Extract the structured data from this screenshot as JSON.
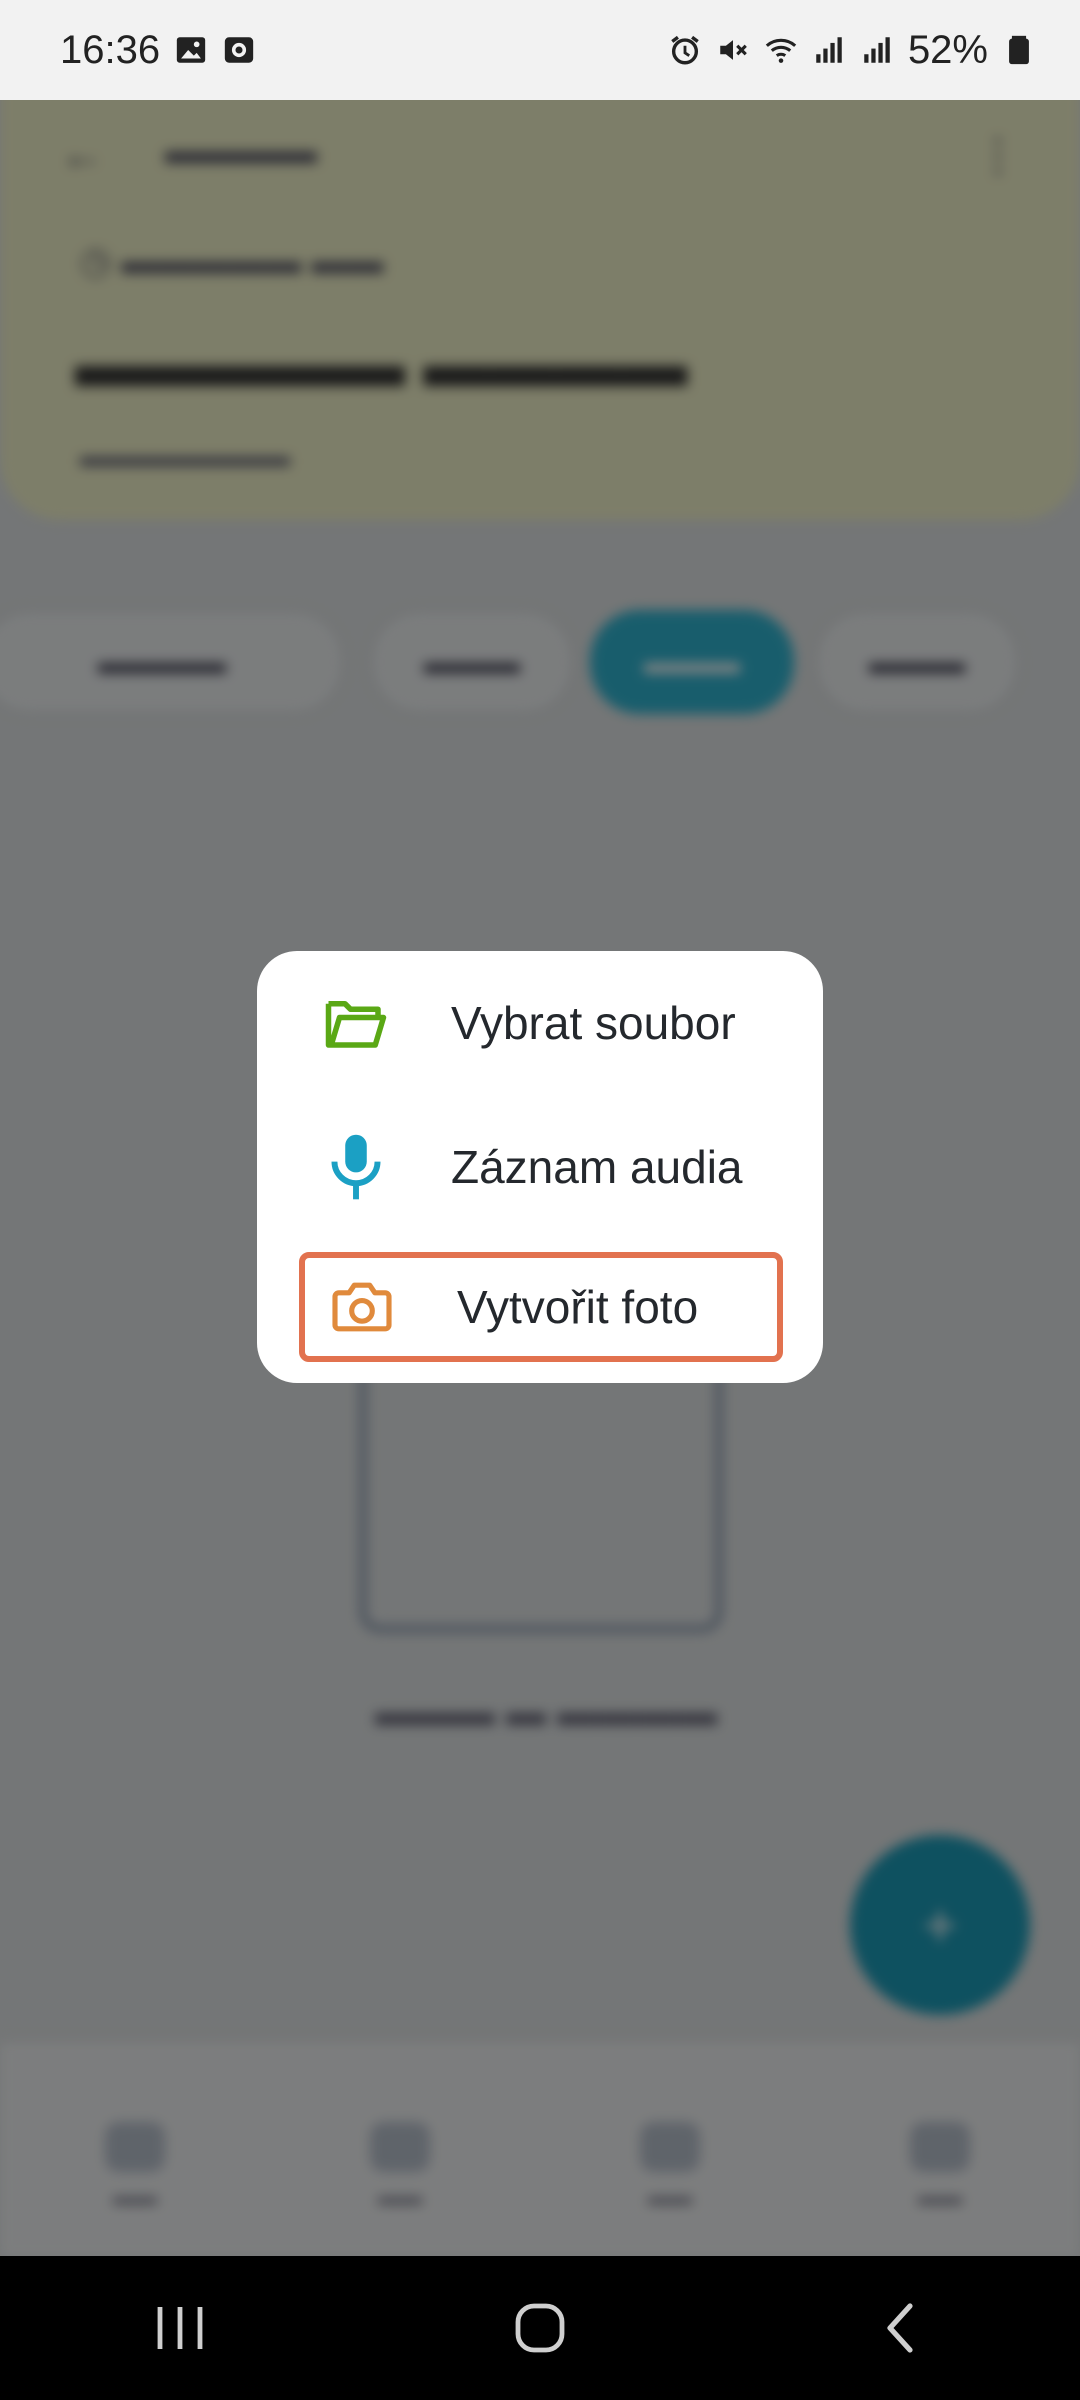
{
  "status_bar": {
    "time": "16:36",
    "battery_percent": "52%",
    "icons_left": [
      "gallery-icon",
      "screen-record-icon"
    ],
    "icons_right": [
      "alarm-icon",
      "mute-icon",
      "wifi-icon",
      "signal-icon",
      "signal-icon",
      "battery-icon"
    ]
  },
  "popup_menu": {
    "items": [
      {
        "label": "Vybrat soubor",
        "icon": "folder-icon",
        "icon_color": "#5aa815"
      },
      {
        "label": "Záznam audia",
        "icon": "microphone-icon",
        "icon_color": "#1ba0c4"
      },
      {
        "label": "Vytvořit foto",
        "icon": "camera-icon",
        "icon_color": "#e08a3c",
        "highlighted": true,
        "highlight_color": "#e2724f"
      }
    ]
  },
  "colors": {
    "accent": "#1c9bb8",
    "header_bg": "#f0f1c9",
    "scrim": "rgba(0,0,0,0.48)"
  },
  "system_nav": {
    "buttons": [
      "recent-apps-icon",
      "home-icon",
      "back-icon"
    ]
  }
}
